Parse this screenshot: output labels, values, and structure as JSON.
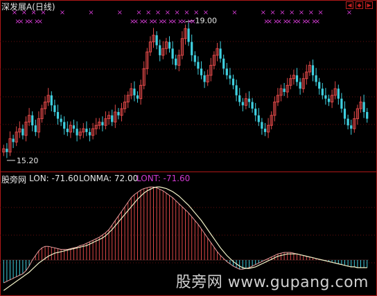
{
  "header": {
    "title": "深发展A",
    "period": "(日线)"
  },
  "indicator": {
    "name": "股旁网",
    "lon_label": "LON: -71.60",
    "lonma_label": "LONMA: 72.00",
    "lont_label": "LONT: -71.60"
  },
  "nav": {
    "left_icon": "arrow-left-icon",
    "zoom_icon": "zoom-icon",
    "right_icon": "arrow-right-icon"
  },
  "watermark": "股旁网 www.gupang.com",
  "colors": {
    "up": "#e04848",
    "down": "#3fd0e0",
    "ma_line": "#f2f2c8",
    "lont": "#d03ad0",
    "signal": "#d03ad0",
    "frame": "#b01818"
  },
  "chart_data": [
    {
      "type": "candlestick",
      "title": "深发展A (日线)",
      "high_annotation": "19.00",
      "low_annotation": "15.20",
      "ylim": [
        14.8,
        19.4
      ],
      "closes": [
        15.4,
        15.3,
        15.7,
        15.6,
        15.9,
        16.0,
        15.8,
        16.2,
        16.4,
        16.1,
        15.9,
        16.3,
        16.6,
        16.8,
        17.0,
        16.7,
        16.5,
        16.3,
        16.2,
        16.0,
        15.9,
        16.1,
        16.0,
        15.8,
        15.9,
        16.0,
        15.9,
        15.8,
        16.0,
        16.1,
        16.2,
        16.1,
        16.3,
        16.4,
        16.2,
        16.5,
        16.4,
        16.6,
        16.8,
        17.0,
        17.2,
        17.0,
        16.9,
        17.3,
        17.8,
        18.3,
        18.6,
        18.8,
        18.5,
        18.2,
        18.4,
        18.6,
        18.4,
        18.1,
        17.9,
        18.2,
        18.7,
        19.0,
        18.6,
        18.2,
        18.0,
        17.8,
        17.6,
        17.4,
        17.6,
        17.9,
        18.2,
        18.4,
        18.1,
        17.8,
        17.6,
        17.5,
        17.3,
        17.0,
        16.8,
        16.7,
        16.9,
        16.8,
        16.6,
        16.4,
        16.2,
        16.0,
        15.9,
        16.1,
        16.4,
        16.8,
        17.0,
        17.2,
        17.1,
        17.3,
        17.5,
        17.6,
        17.4,
        17.2,
        17.5,
        17.7,
        17.9,
        17.6,
        17.4,
        17.2,
        17.0,
        16.9,
        16.8,
        17.0,
        17.2,
        16.9,
        16.6,
        16.3,
        16.1,
        16.0,
        16.3,
        16.6,
        16.8,
        16.5,
        16.3
      ],
      "signal_rows": 2
    },
    {
      "type": "bar",
      "title": "股旁网",
      "series": [
        {
          "name": "LON",
          "values": [
            -30,
            -28,
            -26,
            -24,
            -22,
            -20,
            -18,
            -14,
            -8,
            0,
            6,
            12,
            16,
            18,
            18,
            17,
            16,
            15,
            14,
            14,
            14,
            15,
            16,
            17,
            19,
            20,
            22,
            24,
            26,
            28,
            30,
            33,
            36,
            40,
            46,
            52,
            58,
            64,
            70,
            76,
            82,
            86,
            89,
            92,
            94,
            95,
            96,
            96,
            95,
            93,
            91,
            88,
            85,
            82,
            78,
            74,
            70,
            66,
            62,
            57,
            52,
            47,
            41,
            35,
            29,
            23,
            17,
            11,
            6,
            2,
            -2,
            -5,
            -8,
            -10,
            -12,
            -12,
            -11,
            -10,
            -8,
            -6,
            -4,
            -2,
            0,
            2,
            4,
            6,
            8,
            9,
            10,
            10,
            10,
            9,
            8,
            7,
            6,
            5,
            4,
            3,
            2,
            1,
            0,
            -1,
            -2,
            -3,
            -4,
            -5,
            -6,
            -7,
            -8,
            -9,
            -9,
            -10,
            -10,
            -10,
            -10
          ]
        },
        {
          "name": "LONMA",
          "values": [
            -40,
            -37,
            -34,
            -31,
            -28,
            -25,
            -22,
            -19,
            -16,
            -12,
            -8,
            -4,
            -1,
            2,
            5,
            7,
            9,
            10,
            11,
            12,
            13,
            14,
            15,
            16,
            17,
            18,
            19,
            21,
            23,
            25,
            27,
            29,
            32,
            36,
            40,
            45,
            50,
            55,
            60,
            65,
            70,
            75,
            80,
            84,
            88,
            91,
            93,
            95,
            96,
            96,
            95,
            94,
            92,
            90,
            87,
            84,
            80,
            76,
            72,
            67,
            62,
            57,
            52,
            46,
            40,
            34,
            28,
            22,
            16,
            11,
            6,
            2,
            -2,
            -5,
            -8,
            -10,
            -11,
            -11,
            -10,
            -9,
            -7,
            -5,
            -3,
            -1,
            1,
            3,
            5,
            6,
            7,
            8,
            8,
            8,
            8,
            7,
            6,
            5,
            4,
            3,
            2,
            1,
            0,
            -1,
            -2,
            -3,
            -4,
            -5,
            -6,
            -7,
            -8,
            -9,
            -9,
            -10,
            -10,
            -10,
            -10
          ]
        }
      ]
    }
  ]
}
